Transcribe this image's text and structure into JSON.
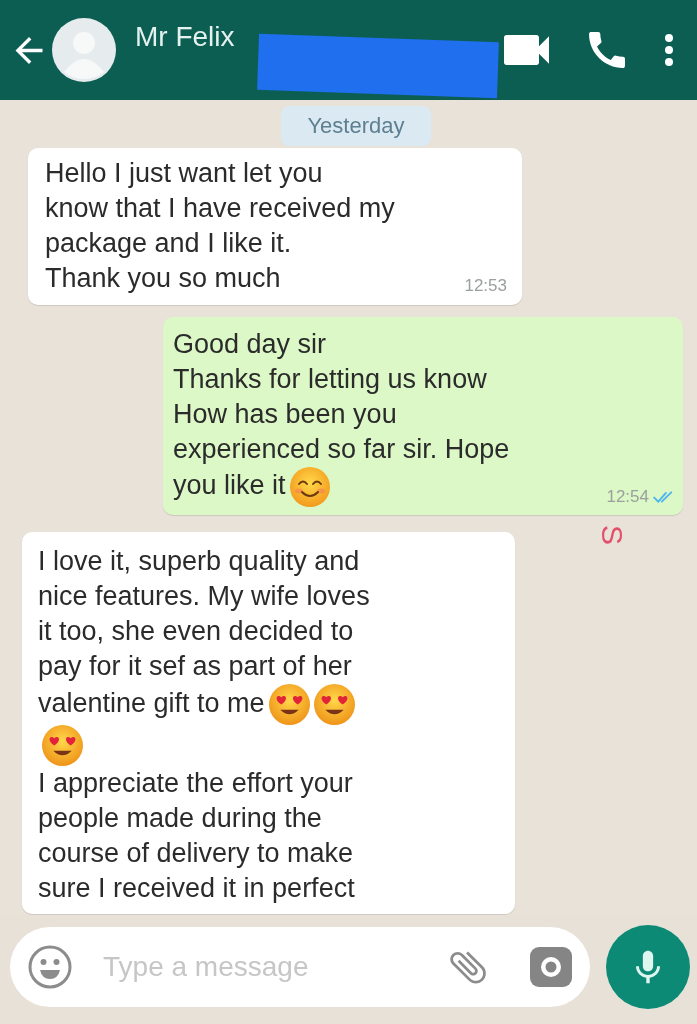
{
  "header": {
    "title": "Mr Felix",
    "redacted": true
  },
  "date_chip": "Yesterday",
  "messages": [
    {
      "outgoing": false,
      "blocks": [
        {
          "text": "Hello I just want let you\nknow that I have received my\npackage and I like it.\nThank you so much"
        }
      ],
      "time": "12:53"
    },
    {
      "outgoing": true,
      "blocks": [
        {
          "text": "Good day sir\nThanks for letting us know\nHow has been you\nexperienced so far sir. Hope"
        },
        {
          "text": "you like it",
          "emojis": [
            {
              "kind": "smiling_face"
            }
          ]
        }
      ],
      "time": "12:54",
      "read": true
    },
    {
      "outgoing": false,
      "blocks": [
        {
          "text": "I love it, superb quality and\nnice features. My wife loves\nit too, she even decided to\npay for it sef as part of her"
        },
        {
          "text": "valentine gift to me",
          "emojis": [
            {
              "kind": "heart_eyes"
            },
            {
              "kind": "heart_eyes"
            },
            {
              "kind": "heart_eyes"
            }
          ]
        },
        {
          "text": "I appreciate the effort your\npeople made during the\ncourse of delivery to make\nsure I received it in perfect"
        }
      ]
    }
  ],
  "stray_mark": "S",
  "composer": {
    "placeholder": "Type a message"
  }
}
